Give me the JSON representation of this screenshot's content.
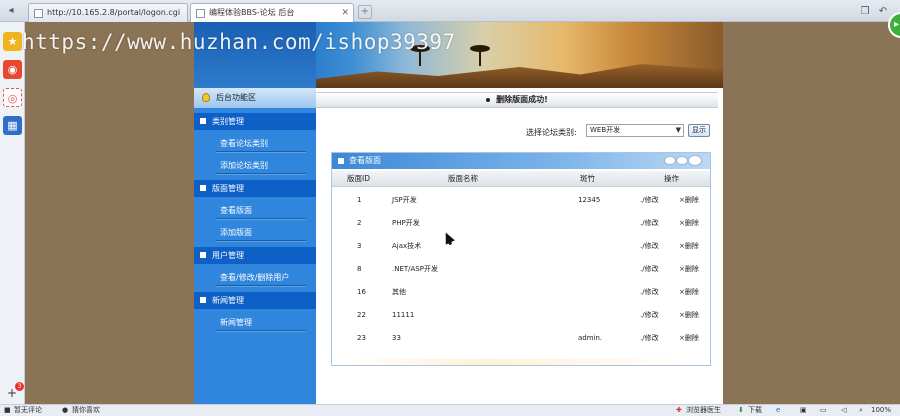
{
  "browser": {
    "tabs": [
      {
        "title": "http://10.165.2.8/portal/logon.cgi",
        "active": false
      },
      {
        "title": "编程体验BBS-论坛 后台",
        "active": true
      }
    ],
    "new_tab_glyph": "+",
    "status": {
      "left_1": "暂无评论",
      "left_2": "猜你喜欢",
      "right_1": "浏览器医生",
      "right_2": "下载",
      "zoom": "100%"
    },
    "leftbar_count": "3"
  },
  "watermark": "https://www.huzhan.com/ishop39397",
  "sidebar": {
    "title": "后台功能区",
    "sections": [
      {
        "title": "类别管理",
        "links": [
          "查看论坛类别",
          "添加论坛类别"
        ]
      },
      {
        "title": "版面管理",
        "links": [
          "查看版面",
          "添加版面"
        ]
      },
      {
        "title": "用户管理",
        "links": [
          "查看/修改/删除用户"
        ]
      },
      {
        "title": "新闻管理",
        "links": [
          "新闻管理"
        ]
      }
    ]
  },
  "main": {
    "message": "删除版面成功!",
    "category_label": "选择论坛类别:",
    "category_value": "WEB开发",
    "show_button": "显示",
    "panel_title": "查看版面",
    "columns": [
      "版面ID",
      "版面名称",
      "斑竹",
      "操作"
    ],
    "rows": [
      {
        "id": "1",
        "name": "JSP开发",
        "moderator": "12345"
      },
      {
        "id": "2",
        "name": "PHP开发",
        "moderator": ""
      },
      {
        "id": "3",
        "name": "Ajax技术",
        "moderator": ""
      },
      {
        "id": "8",
        "name": ".NET/ASP开发",
        "moderator": ""
      },
      {
        "id": "16",
        "name": "其他",
        "moderator": ""
      },
      {
        "id": "22",
        "name": "11111",
        "moderator": ""
      },
      {
        "id": "23",
        "name": "33",
        "moderator": "admin."
      }
    ],
    "edit_label": "./修改",
    "delete_label": "×删除"
  }
}
